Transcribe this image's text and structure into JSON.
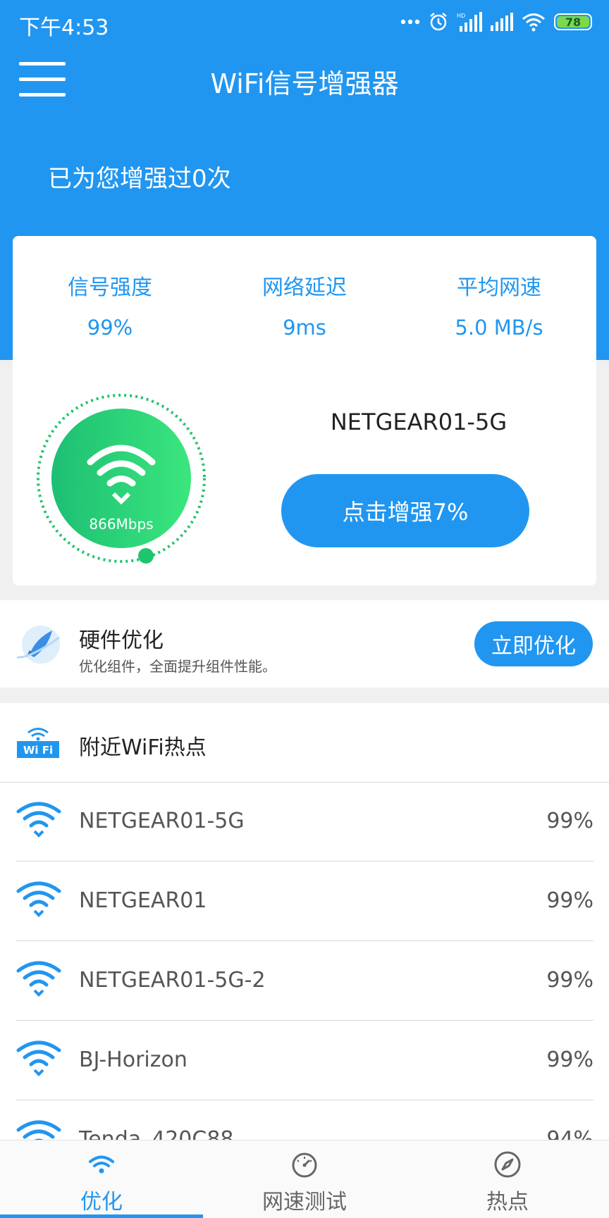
{
  "status_bar": {
    "time": "下午4:53",
    "battery": "78"
  },
  "header": {
    "title": "WiFi信号增强器",
    "boost_count": "已为您增强过0次"
  },
  "stats": [
    {
      "label": "信号强度",
      "value": "99%"
    },
    {
      "label": "网络延迟",
      "value": "9ms"
    },
    {
      "label": "平均网速",
      "value": "5.0 MB/s"
    }
  ],
  "current_connection": {
    "speed": "866Mbps",
    "ssid": "NETGEAR01-5G",
    "boost_button": "点击增强7%"
  },
  "hardware": {
    "title": "硬件优化",
    "desc": "优化组件，全面提升组件性能。",
    "button": "立即优化"
  },
  "nearby": {
    "title": "附近WiFi热点",
    "icon_label": "Wi Fi",
    "items": [
      {
        "ssid": "NETGEAR01-5G",
        "signal": "99%"
      },
      {
        "ssid": "NETGEAR01",
        "signal": "99%"
      },
      {
        "ssid": "NETGEAR01-5G-2",
        "signal": "99%"
      },
      {
        "ssid": "BJ-Horizon",
        "signal": "99%"
      },
      {
        "ssid": "Tenda_420C88",
        "signal": "94%"
      }
    ]
  },
  "tabs": [
    {
      "label": "优化",
      "icon": "wifi-icon",
      "active": true
    },
    {
      "label": "网速测试",
      "icon": "speedometer-icon",
      "active": false
    },
    {
      "label": "热点",
      "icon": "compass-icon",
      "active": false
    }
  ],
  "colors": {
    "primary": "#2196f0",
    "gauge_start": "#1dbf73",
    "gauge_end": "#3be67e"
  }
}
